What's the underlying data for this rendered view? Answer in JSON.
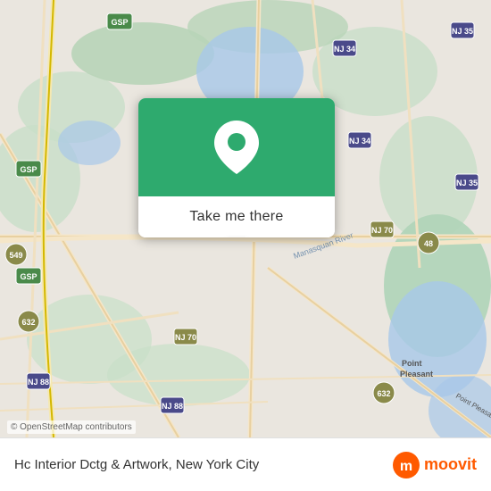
{
  "map": {
    "attribution": "© OpenStreetMap contributors"
  },
  "popup": {
    "button_label": "Take me there",
    "pin_color": "#ffffff"
  },
  "bottom_bar": {
    "location_name": "Hc Interior Dctg & Artwork, New York City",
    "moovit_label": "moovit"
  }
}
